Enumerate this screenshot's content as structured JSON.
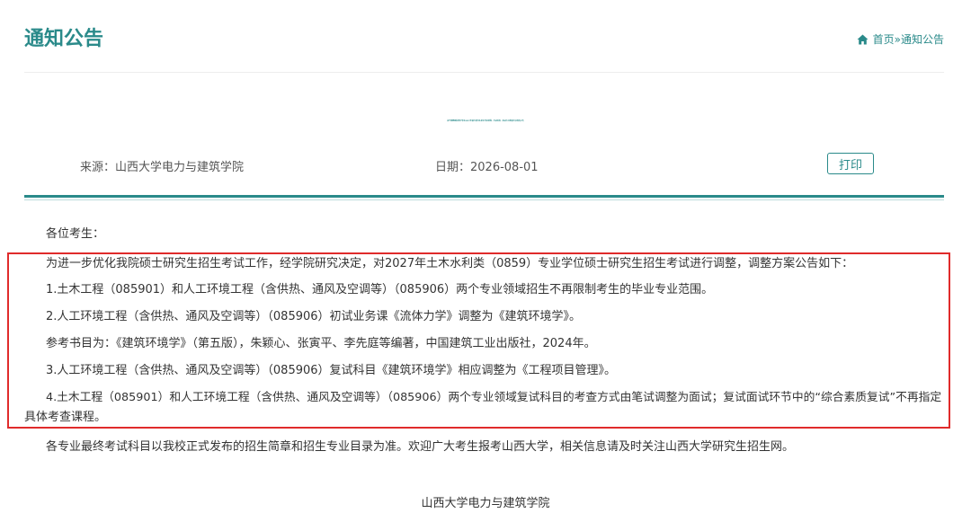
{
  "header": {
    "section_title": "通知公告",
    "breadcrumb": {
      "home": "首页",
      "separator": "»",
      "current": "通知公告"
    }
  },
  "article": {
    "title": "关于调整我院部分专业2027年硕士研究生招生专业范围、考试科目、复试方式和参考书目的公告",
    "source": "来源：山西大学电力与建筑学院",
    "date": "日期：2026-08-01",
    "print_label": "打印",
    "greeting": "各位考生：",
    "highlighted_paragraphs": [
      "为进一步优化我院硕士研究生招生考试工作，经学院研究决定，对2027年土木水利类（0859）专业学位硕士研究生招生考试进行调整，调整方案公告如下：",
      "1.土木工程（085901）和人工环境工程（含供热、通风及空调等）（085906）两个专业领域招生不再限制考生的毕业专业范围。",
      "2.人工环境工程（含供热、通风及空调等）（085906）初试业务课《流体力学》调整为《建筑环境学》。",
      "参考书目为：《建筑环境学》（第五版），朱颖心、张寅平、李先庭等编著，中国建筑工业出版社，2024年。",
      "3.人工环境工程（含供热、通风及空调等）（085906）复试科目《建筑环境学》相应调整为《工程项目管理》。",
      "4.土木工程（085901）和人工环境工程（含供热、通风及空调等）（085906）两个专业领域复试科目的考查方式由笔试调整为面试；复试面试环节中的“综合素质复试”不再指定",
      "具体考查课程。"
    ],
    "closing": "各专业最终考试科目以我校正式发布的招生简章和招生专业目录为准。欢迎广大考生报考山西大学，相关信息请及时关注山西大学研究生招生网。",
    "signature": "山西大学电力与建筑学院"
  },
  "colors": {
    "accent": "#2a8a8a",
    "highlight_border": "#e02b2b",
    "text": "#333333"
  },
  "icons": {
    "breadcrumb_home": "home-icon"
  }
}
